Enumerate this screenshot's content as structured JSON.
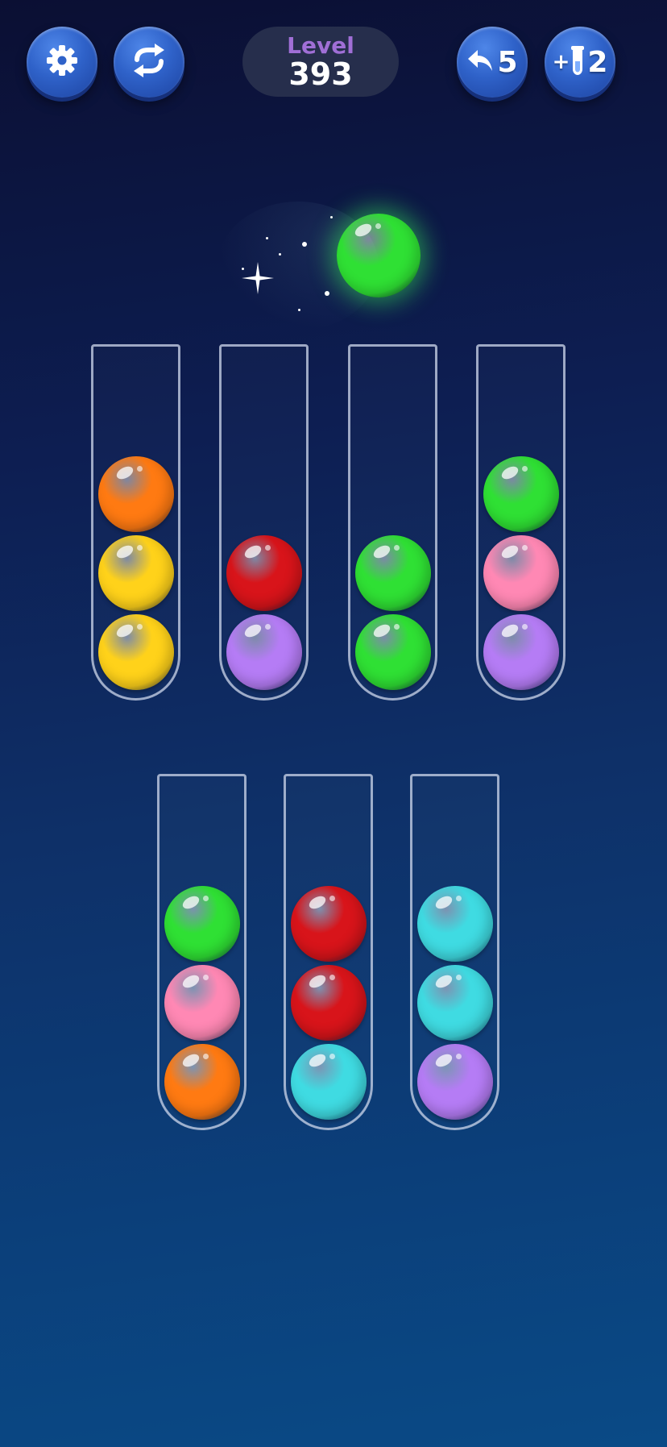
{
  "header": {
    "level_label": "Level",
    "level_number": "393",
    "undo_count": "5",
    "add_tube_count": "2",
    "add_tube_plus": "+"
  },
  "icons": {
    "settings": "gear-icon",
    "restart": "restart-arrows-icon",
    "undo": "undo-arrow-icon",
    "add_tube": "test-tube-icon"
  },
  "colors": {
    "orange": "#ff7a12",
    "yellow": "#ffd21a",
    "red": "#d8141a",
    "purple": "#b57cf5",
    "green": "#2fe034",
    "pink": "#ff88b4",
    "cyan": "#3fdbe2"
  },
  "lifted_ball": "green",
  "tubes_top_row": [
    [
      "orange",
      "yellow",
      "yellow"
    ],
    [
      "red",
      "purple"
    ],
    [
      "green",
      "green"
    ],
    [
      "green",
      "pink",
      "purple"
    ]
  ],
  "tubes_bottom_row": [
    [
      "green",
      "pink",
      "orange"
    ],
    [
      "red",
      "red",
      "cyan"
    ],
    [
      "cyan",
      "cyan",
      "purple"
    ]
  ]
}
